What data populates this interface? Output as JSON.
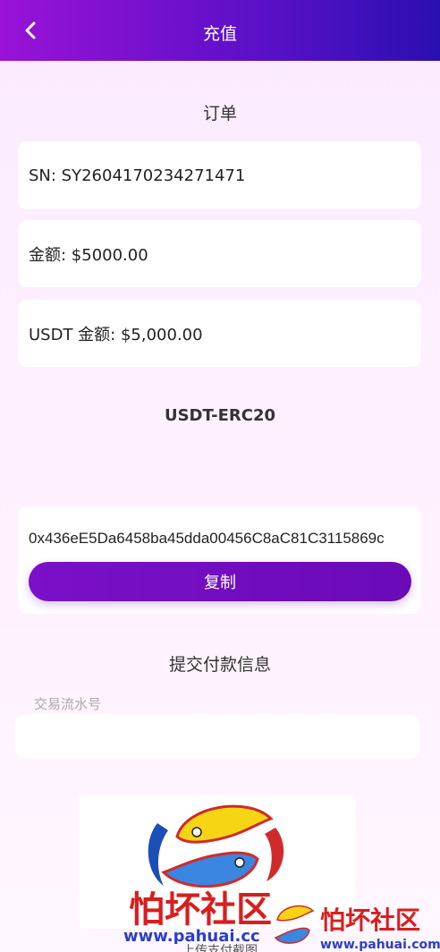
{
  "header": {
    "title": "充值",
    "back_icon": "chevron-left-icon"
  },
  "order": {
    "title": "订单",
    "sn": "SN: SY2604170234271471",
    "amount": "金额: $5000.00",
    "usdt_amount": "USDT 金额: $5,000.00"
  },
  "network": {
    "label": "USDT-ERC20"
  },
  "address": {
    "value": "0x436eE5Da6458ba45dda00456C8aC81C3115869c",
    "copy_label": "复制"
  },
  "submit": {
    "title": "提交付款信息",
    "tx_label": "交易流水号",
    "tx_value": "",
    "upload_hint": "上传支付截图"
  },
  "watermark": {
    "text": "怕坏社区",
    "url": "www.pahuai.cc",
    "url_small": "www.pahuai.com"
  },
  "colors": {
    "accent": "#7a10c8",
    "header_start": "#9a12d6",
    "header_end": "#2a0fb0"
  }
}
